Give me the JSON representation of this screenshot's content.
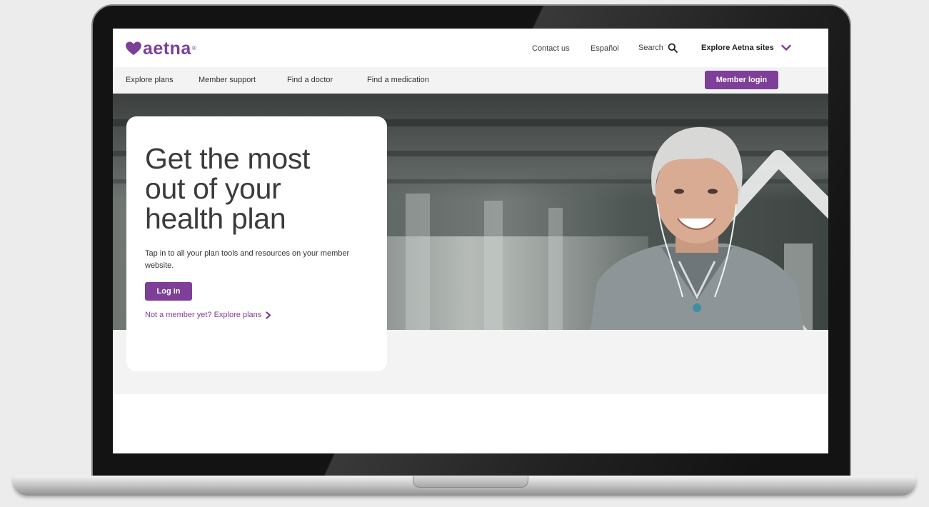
{
  "brand": {
    "name": "aetna",
    "registered": "®",
    "color": "#7d3f98"
  },
  "utility_nav": {
    "contact": "Contact us",
    "espanol": "Español",
    "search": "Search",
    "explore_sites": "Explore Aetna sites"
  },
  "main_nav": {
    "items": [
      {
        "label": "Explore plans"
      },
      {
        "label": "Member support"
      },
      {
        "label": "Find a doctor"
      },
      {
        "label": "Find a medication"
      }
    ],
    "member_login": "Member login"
  },
  "hero": {
    "title_lines": [
      "Get the most",
      "out of your",
      "health plan"
    ],
    "description": "Tap in to all your plan tools and resources on your member website.",
    "login_button": "Log in",
    "explore_link": "Not a member yet? Explore plans"
  },
  "icons": {
    "search": "search-icon",
    "explore_dropdown": "chevron-down-icon",
    "explore_link": "chevron-right-icon",
    "logo": "heart-icon"
  }
}
